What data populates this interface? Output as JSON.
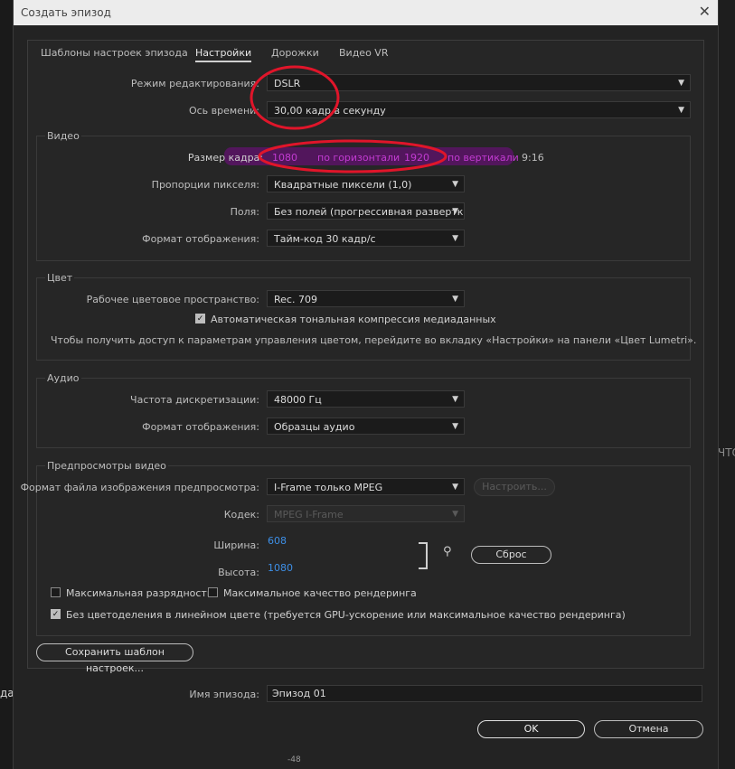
{
  "window": {
    "title": "Создать эпизод"
  },
  "tabs": [
    "Шаблоны настроек эпизода",
    "Настройки",
    "Дорожки",
    "Видео VR"
  ],
  "general": {
    "edit_mode_label": "Режим редактирования:",
    "edit_mode_value": "DSLR",
    "timebase_label": "Ось времени:",
    "timebase_value": "30,00  кадр в секунду"
  },
  "video": {
    "title": "Видео",
    "frame_size_label": "Размер кадра:",
    "frame_width": "1080",
    "horizontal_label": "по горизонтали",
    "frame_height": "1920",
    "vertical_label": "по вертикали",
    "aspect": "9:16",
    "pixel_aspect_label": "Пропорции пикселя:",
    "pixel_aspect_value": "Квадратные пиксели (1,0)",
    "fields_label": "Поля:",
    "fields_value": "Без полей (прогрессивная развертка)",
    "display_format_label": "Формат отображения:",
    "display_format_value": "Тайм-код 30 кадр/с"
  },
  "color": {
    "title": "Цвет",
    "working_space_label": "Рабочее цветовое пространство:",
    "working_space_value": "Rec. 709",
    "tonemap_label": "Автоматическая тональная компрессия медиаданных",
    "tonemap_checked": true,
    "info": "Чтобы получить доступ к параметрам управления цветом, перейдите во вкладку «Настройки» на панели «Цвет Lumetri»."
  },
  "audio": {
    "title": "Аудио",
    "sample_rate_label": "Частота дискретизации:",
    "sample_rate_value": "48000 Гц",
    "display_format_label": "Формат отображения:",
    "display_format_value": "Образцы аудио"
  },
  "previews": {
    "title": "Предпросмотры видео",
    "file_format_label": "Формат файла изображения предпросмотра:",
    "file_format_value": "I-Frame только MPEG",
    "configure_button": "Настроить...",
    "codec_label": "Кодек:",
    "codec_value": "MPEG I-Frame",
    "width_label": "Ширина:",
    "width_value": "608",
    "height_label": "Высота:",
    "height_value": "1080",
    "reset_button": "Сброс",
    "max_depth_label": "Максимальная разрядность",
    "max_depth_checked": false,
    "max_quality_label": "Максимальное качество рендеринга",
    "max_quality_checked": false,
    "linear_color_label": "Без цветоделения в линейном цвете (требуется GPU-ускорение или максимальное качество рендеринга)",
    "linear_color_checked": true
  },
  "save_preset_button": "Сохранить шаблон настроек...",
  "sequence_name_label": "Имя эпизода:",
  "sequence_name_value": "Эпизод 01",
  "ok_button": "OK",
  "cancel_button": "Отмена",
  "background": {
    "left_text": "да,",
    "right_text": "ЧТО",
    "meter": "-48"
  },
  "colors": {
    "annotation": "#e0152a",
    "highlight": "#7a1a87"
  }
}
